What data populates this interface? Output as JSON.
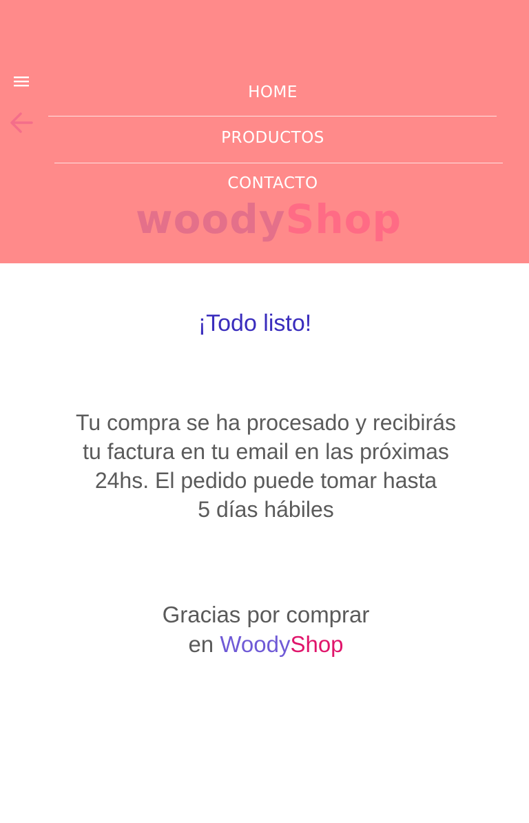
{
  "header": {
    "background": "#ff8a8a",
    "menu_icon": "hamburger-menu-icon",
    "back_icon": "arrow-left-icon",
    "nav": [
      {
        "label": "HOME"
      },
      {
        "label": "PRODUCTOS"
      },
      {
        "label": "CONTACTO"
      }
    ],
    "logo": {
      "part1": "woody",
      "part2": "Shop"
    }
  },
  "main": {
    "title": "¡Todo listo!",
    "title_color": "#3a2dbd",
    "message_lines": [
      "Tu compra se ha procesado y recibirás",
      "tu factura en tu email en las próximas",
      "24hs. El pedido puede tomar hasta",
      "5 días hábiles"
    ],
    "thanks_line1": "Gracias por comprar",
    "thanks_prefix": "en ",
    "brand_part1": "Woody",
    "brand_part2": "Shop",
    "brand_color1": "#6f5ad6",
    "brand_color2": "#e0156b"
  }
}
